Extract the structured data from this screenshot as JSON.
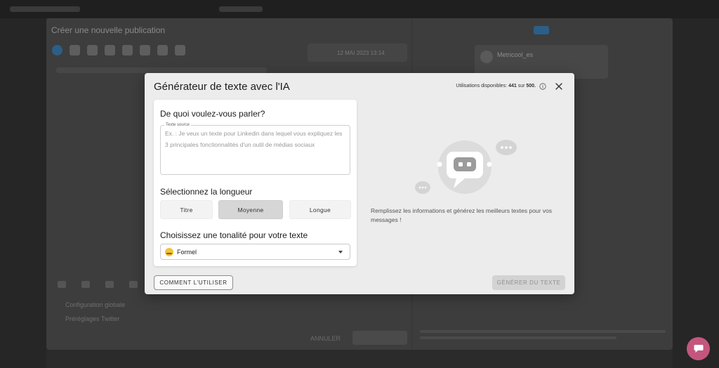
{
  "background": {
    "window_title": "Créer une nouvelle publication",
    "date_value": "12 MAI 2023 13:14",
    "preview_account": "Metricool_es",
    "settings_global": "Configuration globale",
    "settings_twitter": "Préréglages Twitter",
    "cancel_label": "ANNULER"
  },
  "modal": {
    "title": "Générateur de texte avec l'IA",
    "usage": {
      "prefix": "Utilisations disponibles: ",
      "used": "441",
      "middle": " sur ",
      "total": "500."
    },
    "topic": {
      "heading": "De quoi voulez-vous parler?",
      "field_label": "Texte source",
      "placeholder": "Ex. : Je veux un texte pour Linkedin dans lequel vous expliquez les 3 principales fonctionnalités d'un outil de médias sociaux"
    },
    "length": {
      "heading": "Sélectionnez la longueur",
      "options": [
        "Titre",
        "Moyenne",
        "Longue"
      ],
      "selected": "Moyenne"
    },
    "tone": {
      "heading": "Choisissez une tonalité pour votre texte",
      "selected": "Formel",
      "emoji_icon": "face-emoji-icon"
    },
    "empty_state": "Remplissez les informations et générez les meilleurs textes pour vos messages !",
    "how_to_label": "COMMENT L'UTILISER",
    "generate_label": "GÉNÉRER DU TEXTE"
  },
  "colors": {
    "accent_chat": "#c4567e",
    "disabled": "#d3d3d3"
  }
}
